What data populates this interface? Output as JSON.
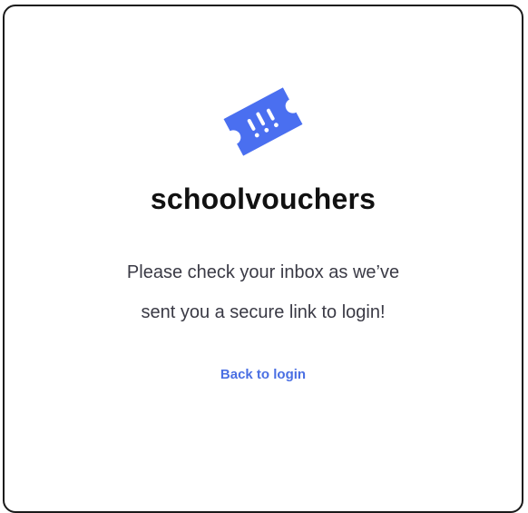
{
  "brand": {
    "name": "schoolvouchers",
    "logo_icon": "ticket-icon",
    "accent_color": "#4a6ff0"
  },
  "message": {
    "line1": "Please check your inbox as we’ve",
    "line2": "sent you a secure link to login!"
  },
  "actions": {
    "back_to_login": "Back to login"
  }
}
